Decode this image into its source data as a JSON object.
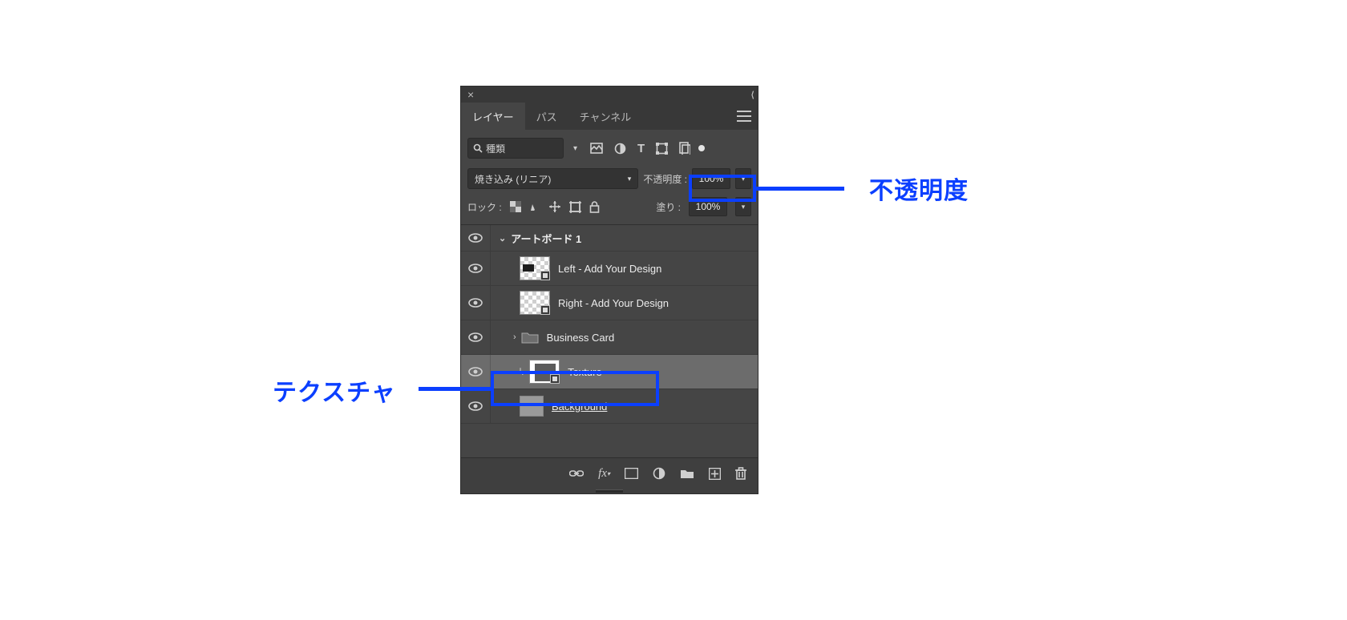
{
  "tabs": {
    "layers": "レイヤー",
    "paths": "パス",
    "channels": "チャンネル"
  },
  "filter": {
    "search_label": "種類"
  },
  "blend": {
    "mode": "焼き込み (リニア)",
    "opacity_label": "不透明度 :",
    "opacity_value": "100%"
  },
  "lock": {
    "label": "ロック :",
    "fill_label": "塗り :",
    "fill_value": "100%"
  },
  "artboard": {
    "name": "アートボード 1"
  },
  "layers": {
    "left_design": "Left - Add Your Design",
    "right_design": "Right - Add Your Design",
    "business_card": "Business Card",
    "texture": "Texture",
    "background": "Background"
  },
  "annotations": {
    "opacity": "不透明度",
    "texture": "テクスチャ"
  }
}
